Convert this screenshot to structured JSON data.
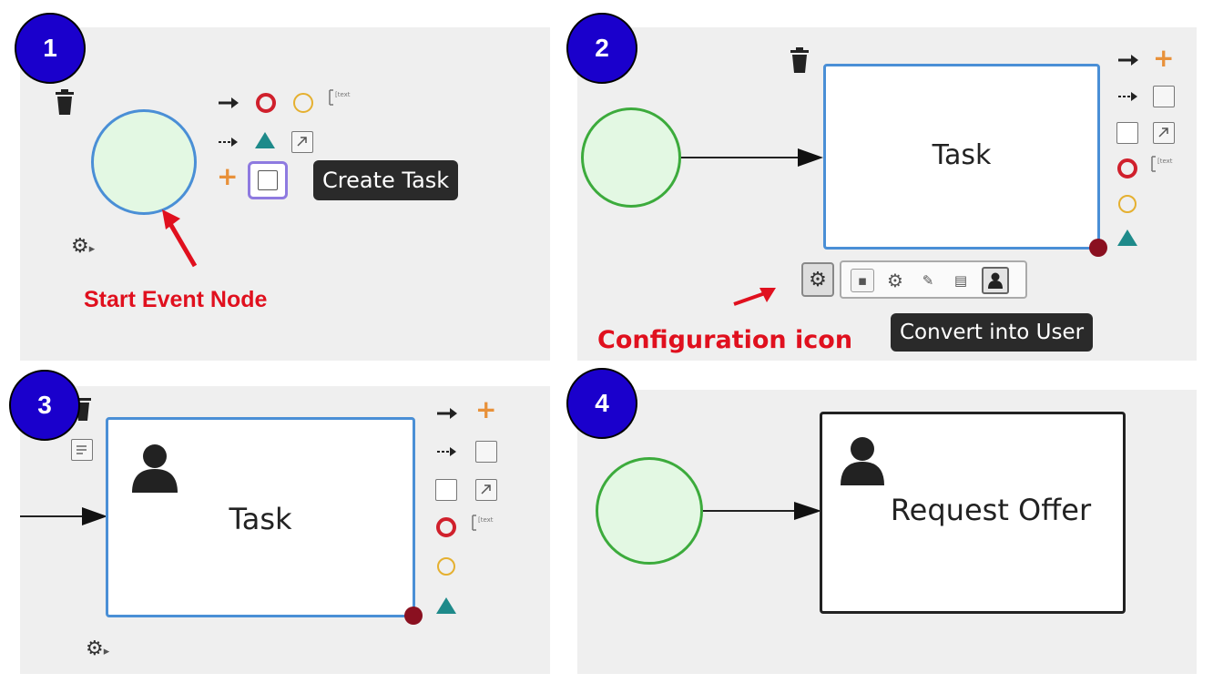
{
  "steps": [
    {
      "number": "1",
      "annotation": "Start Event Node",
      "tooltip": "Create Task"
    },
    {
      "number": "2",
      "task_label": "Task",
      "annotation": "Configuration icon",
      "tooltip": "Convert into User"
    },
    {
      "number": "3",
      "task_label": "Task"
    },
    {
      "number": "4",
      "task_label": "Request Offer"
    }
  ],
  "icons": {
    "text_annotation": "[text"
  },
  "colors": {
    "badge": "#1a00cc",
    "annotation": "#e0101e",
    "selection": "#4a8fd6",
    "start_event": "#3cab3c",
    "end_marker": "#d0202c",
    "timer": "#e5b030",
    "gateway": "#1e8a8a",
    "add": "#e8913a"
  }
}
